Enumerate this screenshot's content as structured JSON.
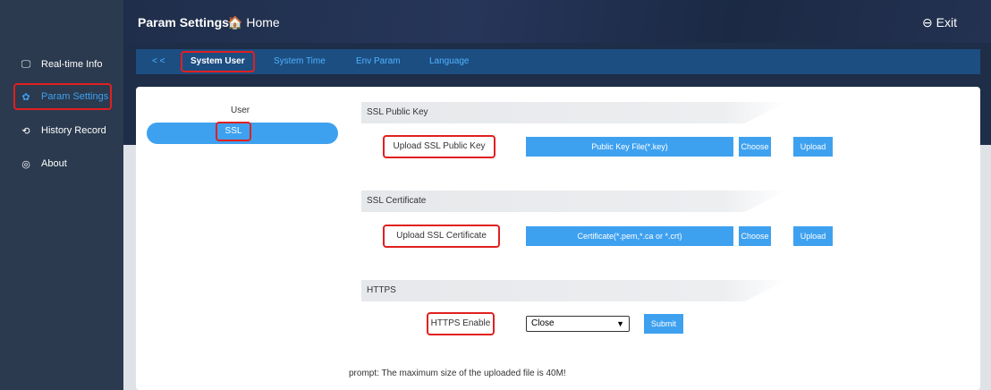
{
  "sidebar": {
    "items": [
      {
        "label": "Real-time Info",
        "icon": "monitor-icon"
      },
      {
        "label": "Param Settings",
        "icon": "gear-icon"
      },
      {
        "label": "History Record",
        "icon": "history-icon"
      },
      {
        "label": "About",
        "icon": "info-icon"
      }
    ]
  },
  "header": {
    "title": "Param Settings",
    "home_icon": "🏠",
    "home_label": "Home",
    "exit_icon": "⊖",
    "exit_label": "Exit"
  },
  "tabs": {
    "back": "< <",
    "items": [
      "System User",
      "System Time",
      "Env Param",
      "Language"
    ]
  },
  "leftnav": {
    "user": "User",
    "ssl": "SSL"
  },
  "sections": {
    "public_key": {
      "header": "SSL Public Key",
      "label": "Upload SSL Public Key",
      "file_placeholder": "Public Key File(*.key)",
      "choose": "Choose",
      "upload": "Upload"
    },
    "certificate": {
      "header": "SSL Certificate",
      "label": "Upload SSL Certificate",
      "file_placeholder": "Certificate(*.pem,*.ca or *.crt)",
      "choose": "Choose",
      "upload": "Upload"
    },
    "https": {
      "header": "HTTPS",
      "label": "HTTPS Enable",
      "select_value": "Close",
      "submit": "Submit"
    }
  },
  "prompt": "prompt:  The maximum size of the uploaded file is 40M!",
  "colors": {
    "accent": "#3ea1f0",
    "sidebar": "#2b3a4e",
    "highlight": "#e02020"
  }
}
